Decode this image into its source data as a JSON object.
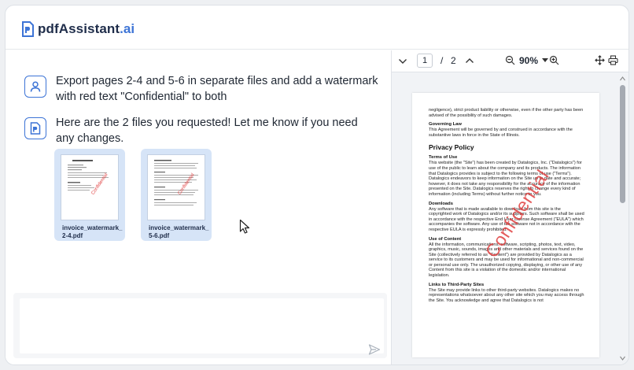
{
  "app": {
    "brand": "pdfAssistant",
    "brand_tld": ".ai",
    "accent_color": "#3d74d6"
  },
  "chat": {
    "messages": [
      {
        "role": "user",
        "icon": "user-icon",
        "text": "Export pages 2-4 and 5-6 in separate files and add a watermark with red text \"Confidential\" to both"
      },
      {
        "role": "assistant",
        "icon": "document-icon",
        "text": "Here are the 2 files you requested! Let me know if you need any changes."
      }
    ],
    "files": [
      {
        "name_line1": "invoice_watermark_",
        "name_line2": "2-4.pdf"
      },
      {
        "name_line1": "invoice_watermark_",
        "name_line2": "5-6.pdf"
      }
    ],
    "input": {
      "value": "",
      "placeholder": ""
    }
  },
  "viewer": {
    "current_page": "1",
    "separator": "/",
    "total_pages": "2",
    "zoom": "90%",
    "watermark_color": "#e04040",
    "doc": {
      "intro": "negligence), strict product liability or otherwise, even if the other party has been advised of the possibility of such damages.",
      "governing_title": "Governing Law",
      "governing_text": "This Agreement will be governed by and construed in accordance with the substantive laws in force in the State of Illinois.",
      "policy_title": "Privacy Policy",
      "terms_title": "Terms of Use",
      "terms_text": "This website (the \"Site\") has been created by Datalogics, Inc. (\"Datalogics\") for use of the public to learn about the company and its products. The information that Datalogics provides is subject to the following terms of use (\"Terms\"). Datalogics endeavors to keep information on the Site up to date and accurate; however, it does not take any responsibility for the accuracy of the information presented on the Site. Datalogics reserves the right to change every kind of information (including Terms) without further notice to you.",
      "downloads_title": "Downloads",
      "downloads_text": "Any software that is made available to download from this site is the copyrighted work of Datalogics and/or its suppliers. Such software shall be used in accordance with the respective End User License Agreement (\"EULA\") which accompanies the software. Any use of the software not in accordance with the respective EULA is expressly prohibited.",
      "content_title": "Use of Content",
      "content_text": "All the information, communications, software, scripting, photos, text, video, graphics, music, sounds, images and other materials and services found on the Site (collectively referred to as \"Content\") are provided by Datalogics as a service to its customers and may be used for informational and non-commercial or personal use only. The unauthorized copying, displaying, or other use of any Content from this site is a violation of the domestic and/or international legislation.",
      "links_title": "Links to Third-Party Sites",
      "links_text": "The Site may provide links to other third-party websites. Datalogics makes no representations whatsoever about any other site which you may access through the Site. You acknowledge and agree that Datalogics is not",
      "watermark": "Confidential"
    }
  }
}
